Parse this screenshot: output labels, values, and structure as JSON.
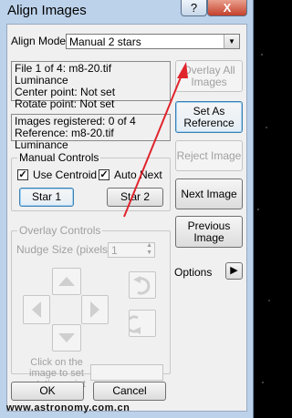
{
  "window": {
    "title": "Align Images",
    "help_label": "?",
    "close_label": "X"
  },
  "align_mode": {
    "label": "Align Mode",
    "selected": "Manual 2 stars"
  },
  "file_info": {
    "line1": "File 1 of 4:  m8-20.tif Luminance",
    "line2": "Center point: Not set",
    "line3": "Rotate point: Not set"
  },
  "reg_info": {
    "line1": "Images registered: 0 of 4",
    "line2": "Reference: m8-20.tif Luminance"
  },
  "buttons": {
    "overlay_all": "Overlay All Images",
    "set_reference": "Set As Reference",
    "reject_image": "Reject Image",
    "next_image": "Next Image",
    "previous_image": "Previous Image",
    "options": "Options",
    "ok": "OK",
    "cancel": "Cancel"
  },
  "manual_controls": {
    "title": "Manual Controls",
    "use_centroid": "Use Centroid",
    "auto_next": "Auto Next",
    "star1": "Star 1",
    "star2": "Star 2",
    "use_centroid_checked": true,
    "auto_next_checked": true
  },
  "overlay_controls": {
    "title": "Overlay Controls",
    "nudge_label": "Nudge Size (pixels)",
    "nudge_value": "1",
    "click_hint": "Click on the image to set rotation point"
  },
  "watermark": "www.astronomy.com.cn",
  "colors": {
    "annotation_arrow": "#e0242c",
    "window_frame": "#bcd2ea",
    "dialog_bg": "#f0f0f0"
  }
}
